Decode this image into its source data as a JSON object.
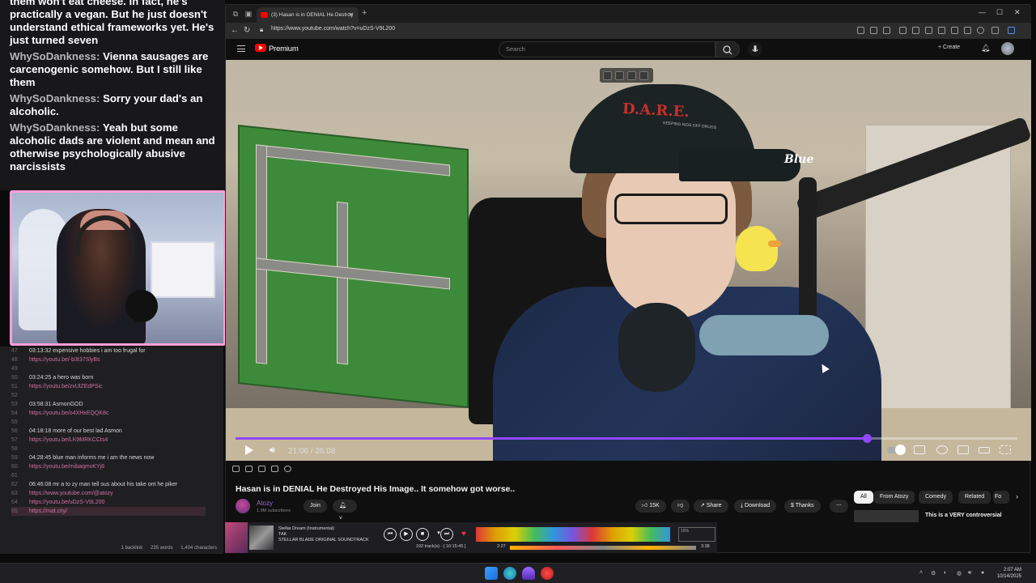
{
  "chat": {
    "messages": [
      {
        "user": "",
        "text": "them won't eat cheese. In fact, he's practically a vegan. But he just doesn't understand ethical frameworks yet. He's just turned seven"
      },
      {
        "user": "WhySoDankness:",
        "text": "Vienna sausages are carcenogenic somehow. But I still like them"
      },
      {
        "user": "WhySoDankness:",
        "text": "Sorry your dad's an alcoholic."
      },
      {
        "user": "WhySoDankness:",
        "text": "Yeah but some alcoholic dads are violent and mean and otherwise psychologically abusive narcissists"
      }
    ]
  },
  "notes": {
    "lines": [
      {
        "n": "47",
        "text": "03:13:32 expensive hobbies i am too frugal for",
        "link": false
      },
      {
        "n": "48",
        "text": "https://youtu.be/-b3t37SlyBs",
        "link": true
      },
      {
        "n": "49",
        "text": "",
        "link": false
      },
      {
        "n": "50",
        "text": "03:24:25 a hero was born",
        "link": false
      },
      {
        "n": "51",
        "text": "https://youtu.be/zxUlZEdPSic",
        "link": true
      },
      {
        "n": "52",
        "text": "",
        "link": false
      },
      {
        "n": "53",
        "text": "03:58:31  AsmonGOD",
        "link": false
      },
      {
        "n": "54",
        "text": "https://youtu.be/o4XHxEQQK8c",
        "link": true
      },
      {
        "n": "55",
        "text": "",
        "link": false
      },
      {
        "n": "56",
        "text": "04:18:18 more of our best lad Asmon",
        "link": false
      },
      {
        "n": "57",
        "text": "https://youtu.be/LK9MRKCCts4",
        "link": true
      },
      {
        "n": "58",
        "text": "",
        "link": false
      },
      {
        "n": "59",
        "text": "04:28:45  blue man informs me i am the news now",
        "link": false
      },
      {
        "n": "60",
        "text": "https://youtu.be/mibaqmvKYj8",
        "link": true
      },
      {
        "n": "61",
        "text": "",
        "link": false
      },
      {
        "n": "62",
        "text": "06:46:08  mr a to zy man tell sus about his take ont he piker",
        "link": false
      },
      {
        "n": "63",
        "text": "https://www.youtube.com/@atozy",
        "link": true
      },
      {
        "n": "64",
        "text": "https://youtu.be/uDzS-V9L200",
        "link": true
      },
      {
        "n": "65",
        "text": "https://mat.city/",
        "link": true
      }
    ],
    "footer": {
      "backlinks": "1 backlink",
      "words": "235 words",
      "chars": "1,404 characters"
    }
  },
  "browser": {
    "tab_title": "(3) Hasan is in DENIAL He Destroy",
    "url": "https://www.youtube.com/watch?v=uDzS-V9L200"
  },
  "youtube": {
    "brand": "Premium",
    "search_placeholder": "Search",
    "create_label": "Create",
    "video": {
      "cap_text": "D.A.R.E.",
      "cap_subtext": "KEEPING KIDS OFF DRUGS",
      "mic_brand": "Blue",
      "time_current": "21:06",
      "time_total": "26:08",
      "time_display": "21:06 / 26:08",
      "progress_fraction": 0.807
    },
    "title": "Hasan is in DENIAL He Destroyed His Image.. It somehow got worse..",
    "channel": {
      "name": "Atozy",
      "subs": "1.9M subscribers",
      "join_label": "Join"
    },
    "actions": {
      "likes": "15K",
      "share": "Share",
      "download": "Download",
      "thanks": "Thanks"
    },
    "filters": [
      "All",
      "From Atozy",
      "Comedy",
      "Related",
      "Fo"
    ],
    "suggested_title": "This is a VERY controversial"
  },
  "player": {
    "track": "Stellar Dream (Instrumental)",
    "artist": "TAK",
    "album": "STELLAR BLADE ORIGINAL SOUNDTRACK",
    "tracks": "192 track(s) - [ 10:15:45 ]",
    "position": "2:27",
    "duration": "3:38",
    "volume": "15%"
  },
  "taskbar": {
    "time": "2:07 AM",
    "date": "10/14/2025"
  },
  "colors": {
    "accent": "#9147ff",
    "youtube_red": "#ff0000",
    "webcam_border": "#ff9ed8"
  }
}
